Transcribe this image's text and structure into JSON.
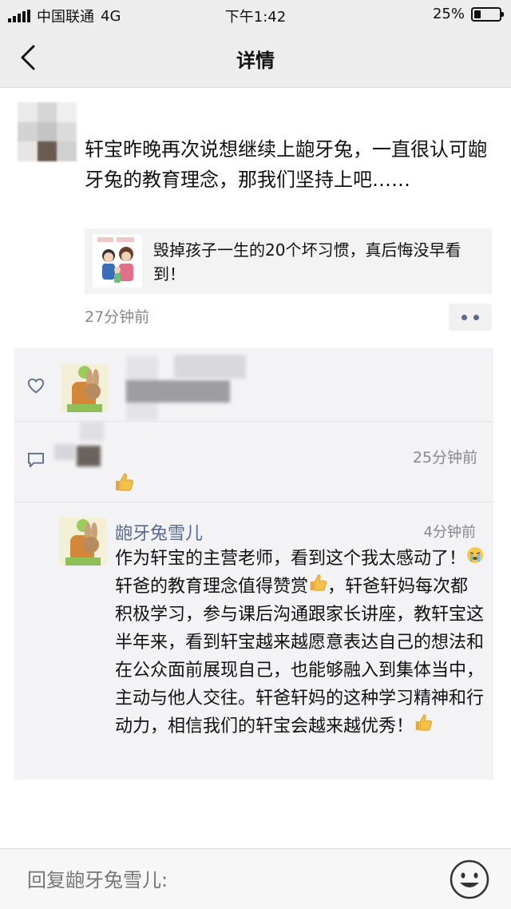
{
  "status_bar": {
    "carrier": "中国联通",
    "network": "4G",
    "time": "下午1:42",
    "battery": "25%",
    "battery_level": 0.25
  },
  "nav": {
    "title": "详情",
    "back_icon": "chevron-left-icon"
  },
  "post": {
    "text": "轩宝昨晚再次说想继续上龅牙兔，一直很认可龅牙兔的教育理念，那我们坚持上吧……",
    "link_title": "毁掉孩子一生的20个坏习惯，真后悔没早看到！",
    "time": "27分钟前",
    "more_icon": "more-dots-icon"
  },
  "likes": {
    "icon": "heart-icon"
  },
  "comment": {
    "icon": "comment-icon",
    "time": "25分钟前",
    "content_icon": "thumbs-up-icon"
  },
  "reply": {
    "name": "龅牙兔雪儿",
    "time": "4分钟前",
    "text_part1": "作为轩宝的主营老师，看到这个我太感动了！",
    "text_part2": "轩爸的教育理念值得赞赏",
    "text_part3": "，轩爸轩妈每次都积极学习，参与课后沟通跟家长讲座，教轩宝这半年来，看到轩宝越来越愿意表达自己的想法和在公众面前展现自己，也能够融入到集体当中，主动与他人交往。轩爸轩妈的这种学习精神和行动力，相信我们的轩宝会越来越优秀！"
  },
  "reply_bar": {
    "placeholder": "回复龅牙兔雪儿:",
    "emoji_icon": "smiley-face-icon"
  },
  "colors": {
    "bar_bg": "#ededed",
    "name_link": "#56698f",
    "secondary_text": "#888888",
    "interaction_bg": "#f3f3f5"
  }
}
